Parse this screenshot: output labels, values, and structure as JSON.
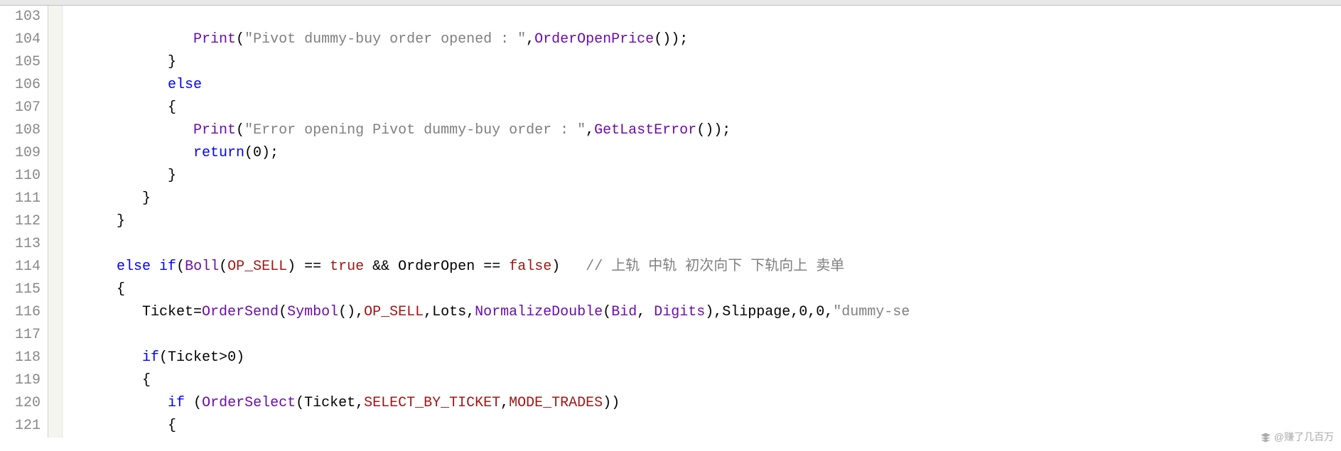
{
  "gutter": {
    "start": 103,
    "end": 121
  },
  "code": {
    "l103": "",
    "l104_indent": "               ",
    "l104_fn": "Print",
    "l104_p1": "(",
    "l104_str": "\"Pivot dummy-buy order opened : \"",
    "l104_c1": ",",
    "l104_fn2": "OrderOpenPrice",
    "l104_p2": "());",
    "l105": "            }",
    "l106_indent": "            ",
    "l106_kw": "else",
    "l107": "            {",
    "l108_indent": "               ",
    "l108_fn": "Print",
    "l108_p1": "(",
    "l108_str": "\"Error opening Pivot dummy-buy order : \"",
    "l108_c1": ",",
    "l108_fn2": "GetLastError",
    "l108_p2": "());",
    "l109_indent": "               ",
    "l109_kw": "return",
    "l109_rest": "(0);",
    "l110": "            }",
    "l111": "         }",
    "l112": "      }",
    "l113": "",
    "l114_indent": "      ",
    "l114_kw1": "else",
    "l114_sp1": " ",
    "l114_kw2": "if",
    "l114_p1": "(",
    "l114_fn": "Boll",
    "l114_p2": "(",
    "l114_const": "OP_SELL",
    "l114_p3": ") == ",
    "l114_bool1": "true",
    "l114_amp": " && ",
    "l114_id": "OrderOpen == ",
    "l114_bool2": "false",
    "l114_p4": ")   ",
    "l114_cmt": "// 上轨 中轨 初次向下 下轨向上 卖单",
    "l115": "      {",
    "l116_indent": "         Ticket=",
    "l116_fn1": "OrderSend",
    "l116_p1": "(",
    "l116_fn2": "Symbol",
    "l116_p2": "(),",
    "l116_const": "OP_SELL",
    "l116_c1": ",Lots,",
    "l116_fn3": "NormalizeDouble",
    "l116_p3": "(",
    "l116_bid": "Bid",
    "l116_c2": ", ",
    "l116_dig": "Digits",
    "l116_p4": "),Slippage,0,0,",
    "l116_str": "\"dummy-se",
    "l117": "",
    "l118_indent": "         ",
    "l118_kw": "if",
    "l118_rest": "(Ticket>0)",
    "l119": "         {",
    "l120_indent": "            ",
    "l120_kw": "if",
    "l120_sp": " (",
    "l120_fn": "OrderSelect",
    "l120_p1": "(Ticket,",
    "l120_const1": "SELECT_BY_TICKET",
    "l120_c1": ",",
    "l120_const2": "MODE_TRADES",
    "l120_p2": "))",
    "l121": "            {"
  },
  "watermark": {
    "text": "@赚了几百万"
  }
}
